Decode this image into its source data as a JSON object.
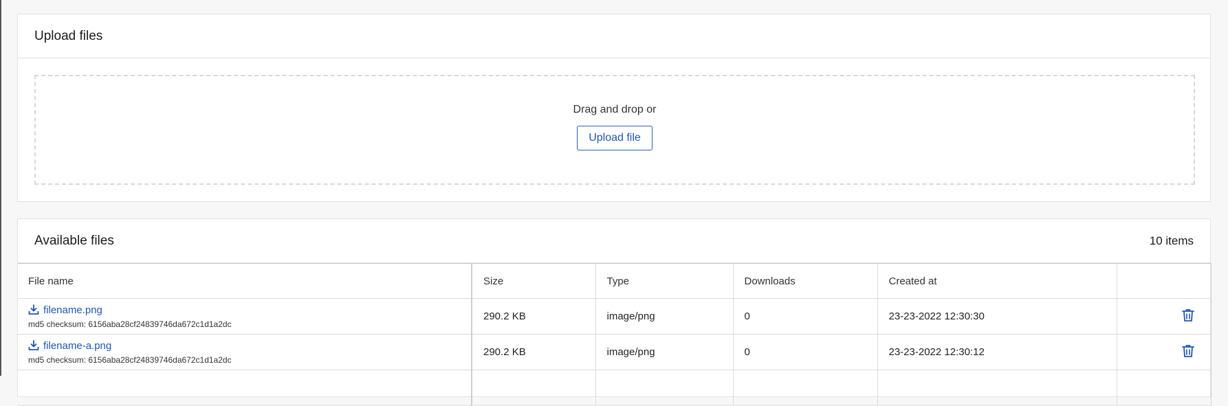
{
  "upload": {
    "title": "Upload files",
    "drop_text": "Drag and drop or",
    "button_label": "Upload file"
  },
  "files": {
    "title": "Available files",
    "count": "10 items",
    "columns": {
      "name": "File name",
      "size": "Size",
      "type": "Type",
      "downloads": "Downloads",
      "created": "Created at",
      "actions": ""
    },
    "rows": [
      {
        "name": "filename.png",
        "checksum": "md5 checksum: 6156aba28cf24839746da672c1d1a2dc",
        "size": "290.2 KB",
        "type": "image/png",
        "downloads": "0",
        "created": "23-23-2022 12:30:30"
      },
      {
        "name": "filename-a.png",
        "checksum": "md5 checksum: 6156aba28cf24839746da672c1d1a2dc",
        "size": "290.2 KB",
        "type": "image/png",
        "downloads": "0",
        "created": "23-23-2022 12:30:12"
      },
      {
        "name": "",
        "checksum": "",
        "size": "",
        "type": "",
        "downloads": "",
        "created": ""
      }
    ]
  },
  "colors": {
    "accent": "#1f56b3",
    "border": "#dcdcdc",
    "background": "#f7f7f7"
  },
  "icons": {
    "download": "download-icon",
    "delete": "trash-icon"
  }
}
